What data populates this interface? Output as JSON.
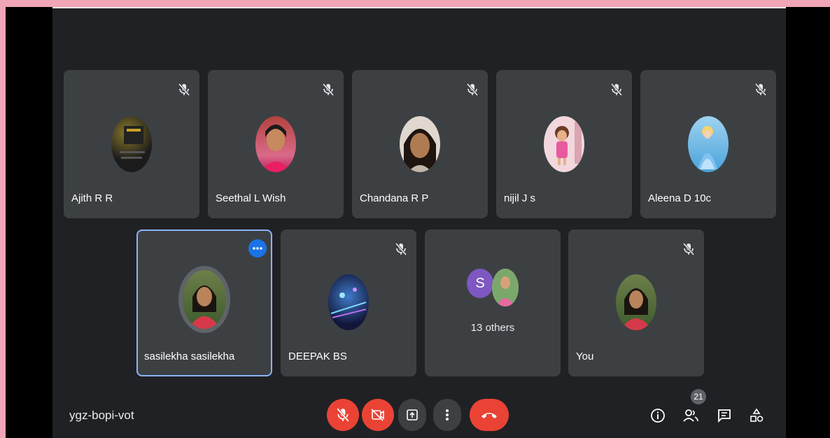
{
  "meeting": {
    "code": "ygz-bopi-vot",
    "participant_count": "21",
    "others_label": "13 others",
    "others_initial": "S"
  },
  "participants": [
    {
      "name": "Ajith R R",
      "muted": true
    },
    {
      "name": "Seethal L Wish",
      "muted": true
    },
    {
      "name": "Chandana R P",
      "muted": true
    },
    {
      "name": "nijil J s",
      "muted": true
    },
    {
      "name": "Aleena D 10c",
      "muted": true
    },
    {
      "name": "sasilekha sasilekha",
      "muted": false,
      "speaking": true
    },
    {
      "name": "DEEPAK BS",
      "muted": true
    },
    {
      "name": "You",
      "muted": true
    }
  ],
  "controls": {
    "mic": "mic-off-icon",
    "camera": "camera-off-icon",
    "present": "present-icon",
    "more": "more-vert-icon",
    "leave": "leave-call-icon",
    "info": "info-icon",
    "people": "people-icon",
    "chat": "chat-icon",
    "activities": "activities-icon"
  },
  "colors": {
    "background": "#202124",
    "tile": "#3c4043",
    "red": "#ea4335",
    "active_border": "#8ab4f8",
    "frame": "#f0a6b4"
  }
}
